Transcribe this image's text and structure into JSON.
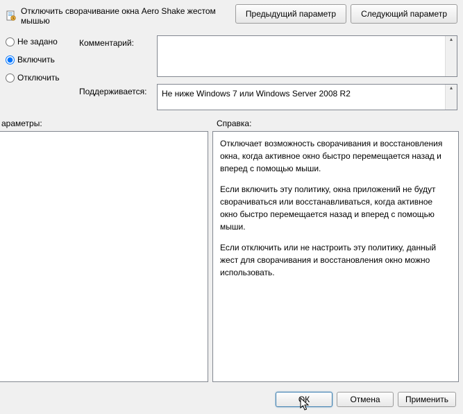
{
  "title": "Отключить сворачивание окна Aero Shake жестом мышью",
  "nav": {
    "prev": "Предыдущий параметр",
    "next": "Следующий параметр"
  },
  "state": {
    "not_configured": "Не задано",
    "enabled": "Включить",
    "disabled": "Отключить",
    "selected": "enabled"
  },
  "fields": {
    "comment_label": "Комментарий:",
    "comment_value": "",
    "supported_label": "Поддерживается:",
    "supported_value": "Не ниже Windows 7 или Windows Server 2008 R2"
  },
  "sections": {
    "options": "араметры:",
    "help": "Справка:"
  },
  "help_paragraphs": [
    "Отключает возможность сворачивания и восстановления окна, когда активное окно быстро перемещается назад и вперед с помощью мыши.",
    "Если включить эту политику, окна приложений не будут сворачиваться или восстанавливаться, когда активное окно быстро перемещается назад и вперед с помощью мыши.",
    "Если отключить или не настроить эту политику, данный жест для сворачивания и восстановления окно можно использовать."
  ],
  "footer": {
    "ok": "ОК",
    "cancel": "Отмена",
    "apply": "Применить"
  }
}
